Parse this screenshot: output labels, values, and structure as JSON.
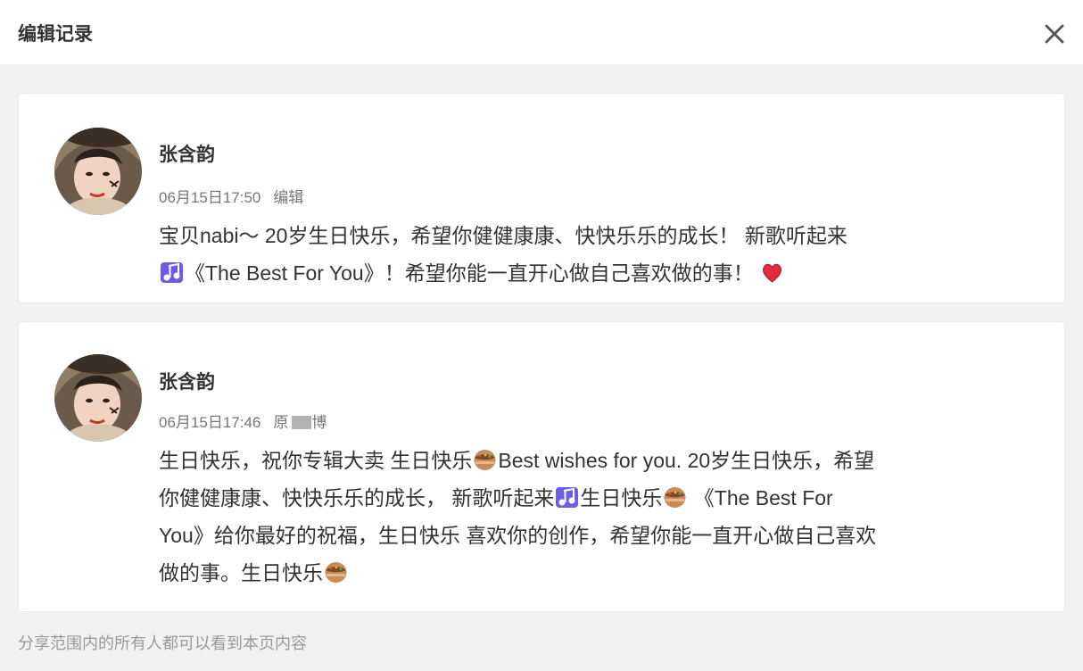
{
  "dialog": {
    "title": "编辑记录",
    "close_icon": "close-icon"
  },
  "records": [
    {
      "author": "张含韵",
      "time": "06月15日17:50",
      "tag": "编辑",
      "text_a": "宝贝nabi～ 20岁生日快乐，希望你健健康康、快快乐乐的成长！ 新歌听起来",
      "text_b": "《The Best For You》！希望你能一直开心做自己喜欢做的事！"
    },
    {
      "author": "张含韵",
      "time": "06月15日17:46",
      "tag": "原",
      "tag_tail": "博",
      "text_a": "生日快乐，祝你专辑大卖 生日快乐",
      "text_b": "Best wishes for you. 20岁生日快乐，希望",
      "text_c": "你健健康康、快快乐乐的成长， 新歌听起来",
      "text_d": "生日快乐",
      "text_e": " 《The Best For",
      "text_f": "You》给你最好的祝福，生日快乐 喜欢你的创作，希望你能一直开心做自己喜欢",
      "text_g": "做的事。生日快乐"
    }
  ],
  "footer": "分享范围内的所有人都可以看到本页内容",
  "colors": {
    "background": "#f2f2f2",
    "card": "#ffffff",
    "text": "#333333",
    "muted": "#999999"
  }
}
